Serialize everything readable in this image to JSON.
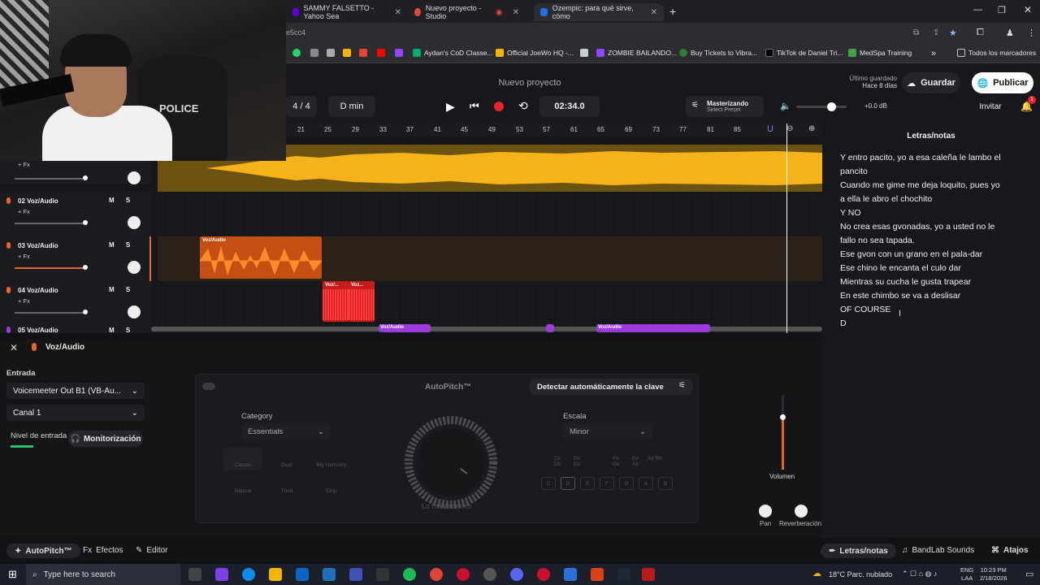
{
  "browser": {
    "tabs": [
      {
        "label": "SAMMY FALSETTO - Yahoo Sea",
        "color": "#6001d2"
      },
      {
        "label": "Nuevo proyecto - Studio",
        "color": "#e8453c"
      },
      {
        "label": "Ozempic: para qué sirve, cómo",
        "color": "#1a73e8"
      }
    ],
    "url_fragment": "e5cc4",
    "bookmarks": [
      "Aydan's CoD Classe...",
      "Official JoeWo HQ -...",
      "ZOMBIE BAILANDO...",
      "Buy Tickets to Vibra...",
      "TikTok de Daniel Tri...",
      "MedSpa Training"
    ],
    "all_bookmarks": "Todos los marcadores"
  },
  "app": {
    "title": "Nuevo proyecto",
    "saved_label": "Último guardado",
    "saved_time": "Hace 8 días",
    "save_button": "Guardar",
    "publish_button": "Publicar",
    "invite_button": "Invitar",
    "notif_count": "1",
    "time_sig": "4 / 4",
    "key": "D min",
    "time": "02:34.0",
    "mastering_title": "Masterizando",
    "mastering_preset": "Select Preset",
    "master_db": "+0.0 dB",
    "ruler_ticks": [
      "21",
      "25",
      "29",
      "33",
      "37",
      "41",
      "45",
      "49",
      "53",
      "57",
      "61",
      "65",
      "69",
      "73",
      "77",
      "81",
      "85"
    ]
  },
  "tracks": [
    {
      "name": "",
      "fx": "+ Fx"
    },
    {
      "name": "02  Voz/Audio",
      "fx": "+ Fx"
    },
    {
      "name": "03  Voz/Audio",
      "fx": "+ Fx"
    },
    {
      "name": "04  Voz/Audio",
      "fx": "+ Fx"
    },
    {
      "name": "05  Voz/Audio",
      "fx": ""
    }
  ],
  "ms": "M S",
  "clips": {
    "track3": "Voz/Audio",
    "track4a": "Voz/...",
    "track4b": "Voz...",
    "bottom1": "Voz/Audio",
    "bottom2": "Voz/Audio"
  },
  "lyrics": {
    "title": "Letras/notas",
    "lines": [
      "Y entro pacito, yo a esa caleña le lambo el",
      "pancito",
      "Cuando me gime me deja loquito, pues yo",
      "a ella le abro el chochito",
      "Y NO",
      "No crea esas gvonadas, yo a usted no le",
      "fallo no sea tapada.",
      "Ese gvon con un grano en el pala-dar",
      "Ese chino le encanta el culo dar",
      "Mientras su cucha le gusta trapear",
      "En este chimbo se va a deslisar",
      "OF COURSE",
      "D"
    ]
  },
  "panel": {
    "track_title": "Voz/Audio",
    "input_label": "Entrada",
    "input_device": "Voicemeeter Out B1 (VB-Au...",
    "channel": "Canal 1",
    "level_label": "Nivel de entrada",
    "monitor_button": "Monitorización",
    "autopitch_title": "AutoPitch™",
    "detect_button": "Detectar automáticamente la clave",
    "category_label": "Category",
    "category_value": "Essentials",
    "scale_label": "Escala",
    "scale_value": "Minor",
    "effects": [
      "Classic",
      "Duet",
      "Big Harmony",
      "Natural",
      "Third",
      "Chip"
    ],
    "keys": [
      "C",
      "D",
      "E",
      "F",
      "G",
      "A",
      "B"
    ],
    "sharps": [
      "C# Db",
      "D# Eb",
      "F# Gb",
      "G# Ab",
      "A# Bb"
    ],
    "knob_label": "Lo más intenso",
    "volume_label": "Volumen",
    "pan_label": "Pan",
    "reverb_label": "Reverberación"
  },
  "footer": {
    "autopitch": "AutoPitch™",
    "effects": "Efectos",
    "editor": "Editor",
    "lyrics": "Letras/notas",
    "sounds": "BandLab Sounds",
    "shortcuts": "Atajos"
  },
  "taskbar": {
    "search": "Type here to search",
    "weather": "18°C  Parc. nublado",
    "lang": "ENG",
    "region": "LAA",
    "time": "10:23 PM",
    "date": "2/18/2026"
  }
}
